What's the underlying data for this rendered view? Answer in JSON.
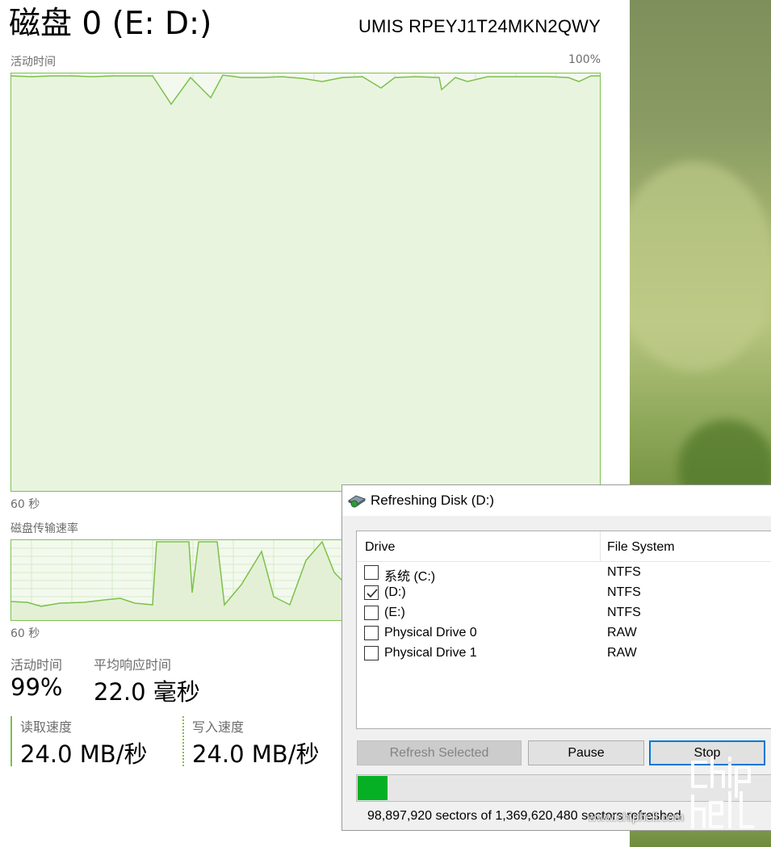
{
  "header": {
    "title": "磁盘 0 (E: D:)",
    "model": "UMIS RPEYJ1T24MKN2QWY"
  },
  "activity_graph": {
    "label": "活动时间",
    "max_label": "100%",
    "time_label": "60 秒"
  },
  "transfer_graph": {
    "label": "磁盘传输速率",
    "time_label": "60 秒"
  },
  "stats": {
    "active_time_label": "活动时间",
    "active_time_value": "99%",
    "avg_response_label": "平均响应时间",
    "avg_response_value": "22.0 毫秒",
    "read_label": "读取速度",
    "read_value": "24.0 MB/秒",
    "write_label": "写入速度",
    "write_value": "24.0 MB/秒"
  },
  "dialog": {
    "title": "Refreshing Disk (D:)",
    "columns": {
      "drive": "Drive",
      "fs": "File System"
    },
    "rows": [
      {
        "name": "系统 (C:)",
        "fs": "NTFS",
        "checked": false
      },
      {
        "name": "(D:)",
        "fs": "NTFS",
        "checked": true
      },
      {
        "name": "(E:)",
        "fs": "NTFS",
        "checked": false
      },
      {
        "name": "Physical Drive 0",
        "fs": "RAW",
        "checked": false
      },
      {
        "name": "Physical Drive 1",
        "fs": "RAW",
        "checked": false
      }
    ],
    "buttons": {
      "refresh": "Refresh Selected",
      "pause": "Pause",
      "stop": "Stop"
    },
    "progress_fraction": 0.072,
    "status": "98,897,920 sectors of 1,369,620,480 sectors refreshed"
  },
  "watermark": {
    "text": "www.chiphell.com",
    "logo": "chip hell"
  },
  "colors": {
    "graph_line": "#7cc14a",
    "graph_fill": "#f3f9ee",
    "progress": "#06b025",
    "accent": "#0078d7"
  }
}
